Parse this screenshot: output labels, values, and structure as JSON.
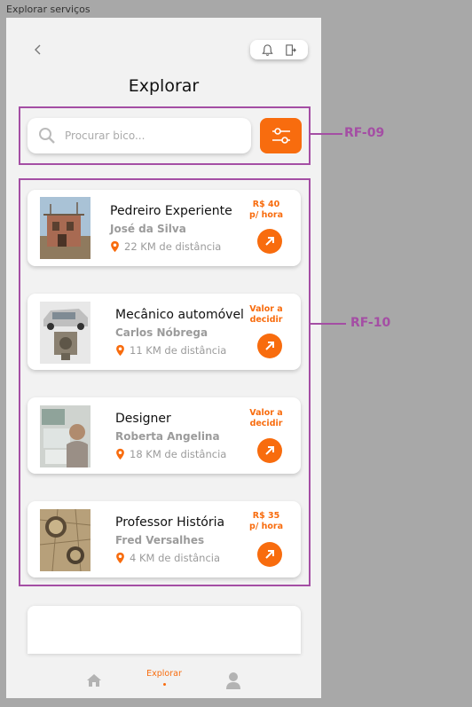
{
  "window": {
    "title": "Explorar serviços"
  },
  "header": {
    "title": "Explorar",
    "back_icon": "chevron-left-icon",
    "notification_icon": "bell-icon",
    "logout_icon": "logout-icon"
  },
  "search": {
    "placeholder": "Procurar bico..."
  },
  "services": [
    {
      "title": "Pedreiro Experiente",
      "person": "José da Silva",
      "distance": "22 KM de distância",
      "price_line1": "R$ 40",
      "price_line2": "p/ hora"
    },
    {
      "title": "Mecânico automóvel",
      "person": "Carlos Nóbrega",
      "distance": "11 KM de distância",
      "price_line1": "Valor a",
      "price_line2": "decidir"
    },
    {
      "title": "Designer",
      "person": "Roberta Angelina",
      "distance": "18 KM de distância",
      "price_line1": "Valor a",
      "price_line2": "decidir"
    },
    {
      "title": "Professor História",
      "person": "Fred Versalhes",
      "distance": "4 KM de distância",
      "price_line1": "R$ 35",
      "price_line2": "p/ hora"
    }
  ],
  "bottom_nav": {
    "explore_label": "Explorar"
  },
  "annotations": {
    "search_req": "RF-09",
    "list_req": "RF-10"
  },
  "colors": {
    "accent": "#f86c0e",
    "annotation": "#a44ea4",
    "background": "#f2f2f2"
  }
}
